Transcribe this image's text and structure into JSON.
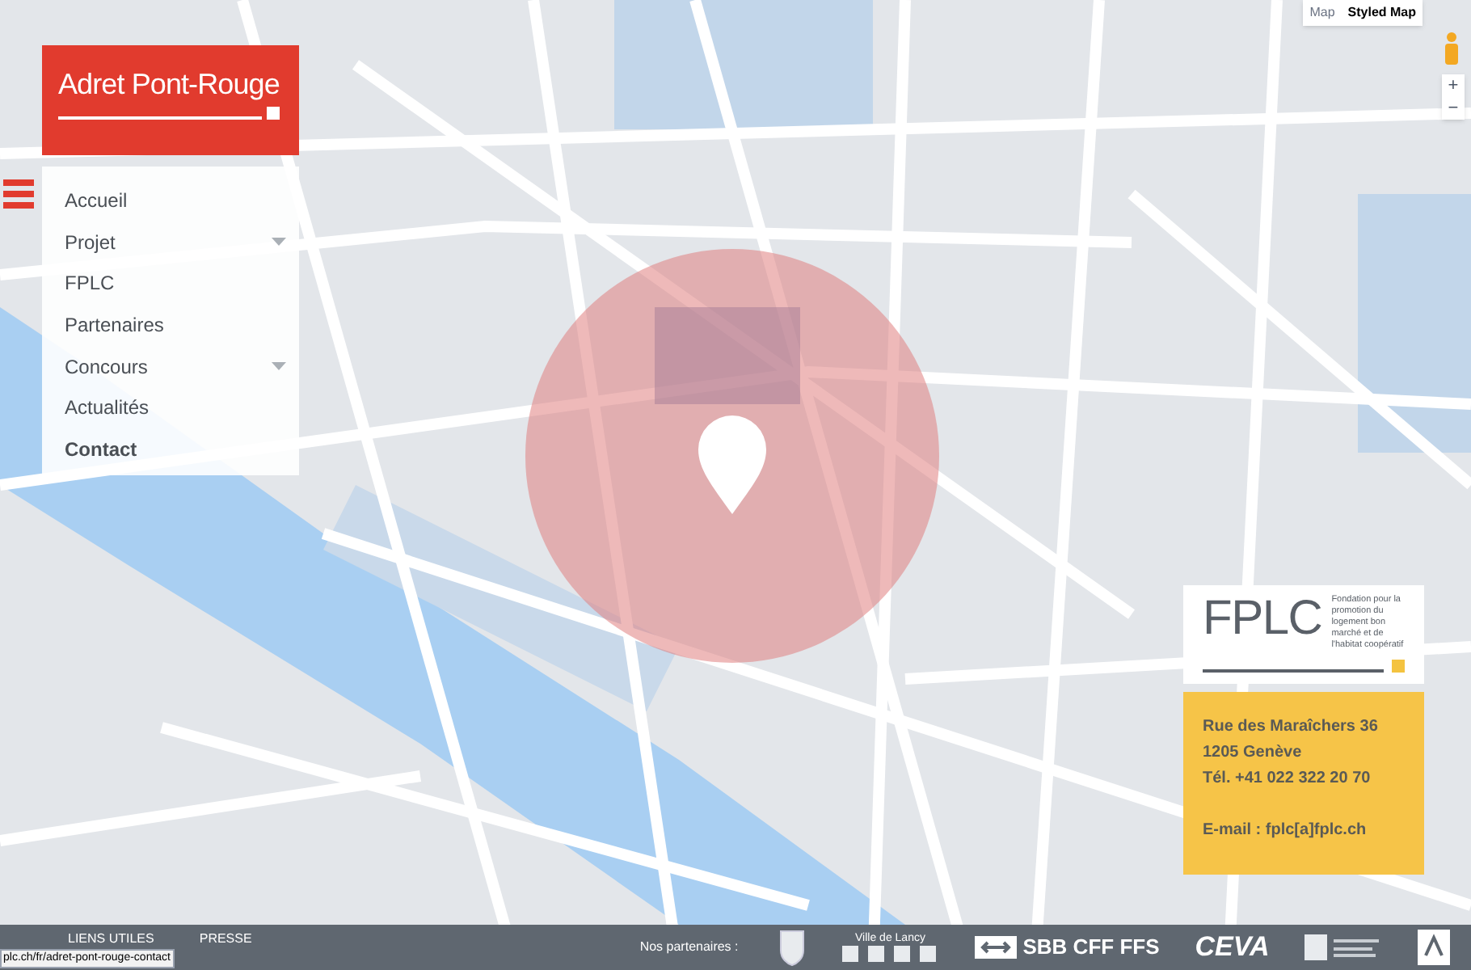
{
  "map": {
    "type_buttons": [
      {
        "label": "Map",
        "selected": false
      },
      {
        "label": "Styled Map",
        "selected": true
      }
    ],
    "zoom_in": "+",
    "zoom_out": "−"
  },
  "brand": {
    "title": "Adret Pont-Rouge"
  },
  "menu": {
    "items": [
      {
        "label": "Accueil",
        "has_submenu": false,
        "selected": false
      },
      {
        "label": "Projet",
        "has_submenu": true,
        "selected": false
      },
      {
        "label": "FPLC",
        "has_submenu": false,
        "selected": false
      },
      {
        "label": "Partenaires",
        "has_submenu": false,
        "selected": false
      },
      {
        "label": "Concours",
        "has_submenu": true,
        "selected": false
      },
      {
        "label": "Actualités",
        "has_submenu": false,
        "selected": false
      },
      {
        "label": "Contact",
        "has_submenu": false,
        "selected": true
      }
    ]
  },
  "fplc_card": {
    "logo_text": "FPLC",
    "tagline": "Fondation pour la promotion du logement bon marché et de l'habitat coopératif",
    "address_lines": [
      "Rue des Maraîchers 36",
      "1205 Genève",
      "Tél. +41 022 322 20 70"
    ],
    "email": "E-mail : fplc[a]fplc.ch"
  },
  "footer": {
    "links": [
      "LIENS UTILES",
      "PRESSE"
    ],
    "partners_label": "Nos partenaires :",
    "partners": [
      {
        "kind": "crest"
      },
      {
        "kind": "lancy",
        "label": "Ville de Lancy"
      },
      {
        "kind": "sbb",
        "label": "SBB CFF FFS"
      },
      {
        "kind": "ceva",
        "label": "CEVA"
      },
      {
        "kind": "block"
      },
      {
        "kind": "badge"
      }
    ]
  },
  "status_url": "plc.ch/fr/adret-pont-rouge-contact"
}
